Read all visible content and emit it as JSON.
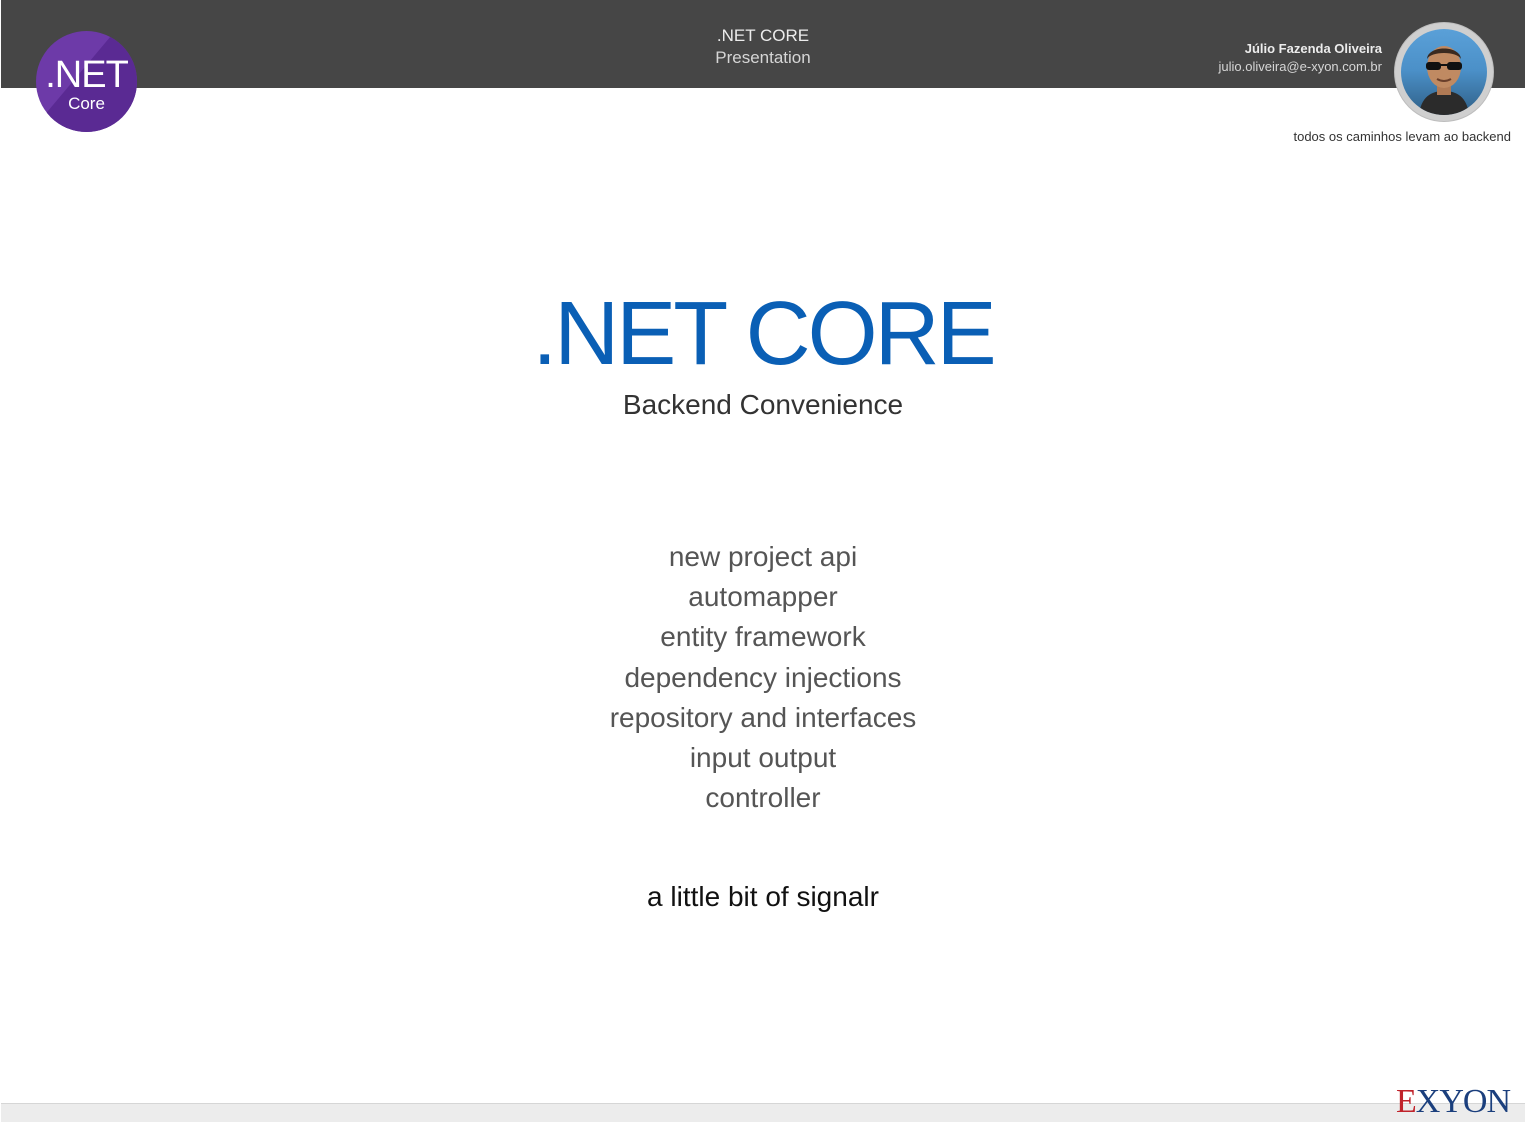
{
  "header": {
    "title": ".NET CORE",
    "subtitle": "Presentation"
  },
  "logo": {
    "big": ".NET",
    "small": "Core",
    "color": "#6d3aa8"
  },
  "author": {
    "name": "Júlio Fazenda Oliveira",
    "email": "julio.oliveira@e-xyon.com.br"
  },
  "tagline": "todos os caminhos levam ao backend",
  "slide": {
    "title": ".NET CORE",
    "subtitle": "Backend Convenience",
    "title_color": "#0a5fb5",
    "topics": [
      "new project api",
      "automapper",
      "entity framework",
      "dependency injections",
      "repository and interfaces",
      "input output",
      "controller"
    ],
    "extra": "a little bit of signalr"
  },
  "footer": {
    "brand_prefix": "E",
    "brand_rest": "XYON"
  }
}
